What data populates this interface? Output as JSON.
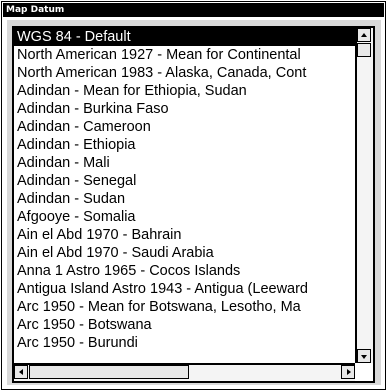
{
  "window": {
    "title": "Map Datum"
  },
  "datum_list": {
    "items": [
      "WGS 84 - Default",
      "North American 1927 - Mean for Continental",
      "North American 1983 - Alaska, Canada, Cont",
      "Adindan - Mean for Ethiopia, Sudan",
      "Adindan - Burkina Faso",
      "Adindan - Cameroon",
      "Adindan - Ethiopia",
      "Adindan - Mali",
      "Adindan - Senegal",
      "Adindan - Sudan",
      "Afgooye - Somalia",
      "Ain el Abd 1970 - Bahrain",
      "Ain el Abd 1970 - Saudi Arabia",
      "Anna 1 Astro 1965 - Cocos Islands",
      "Antigua Island Astro 1943 - Antigua (Leeward",
      "Arc 1950 - Mean for Botswana, Lesotho, Ma",
      "Arc 1950 - Botswana",
      "Arc 1950 - Burundi"
    ],
    "selected_index": 0
  },
  "scrollbars": {
    "vertical_icon_up": "arrow-up-icon",
    "vertical_icon_down": "arrow-down-icon",
    "horizontal_icon_left": "arrow-left-icon",
    "horizontal_icon_right": "arrow-right-icon",
    "vertical_position": 0,
    "horizontal_position": 0
  }
}
